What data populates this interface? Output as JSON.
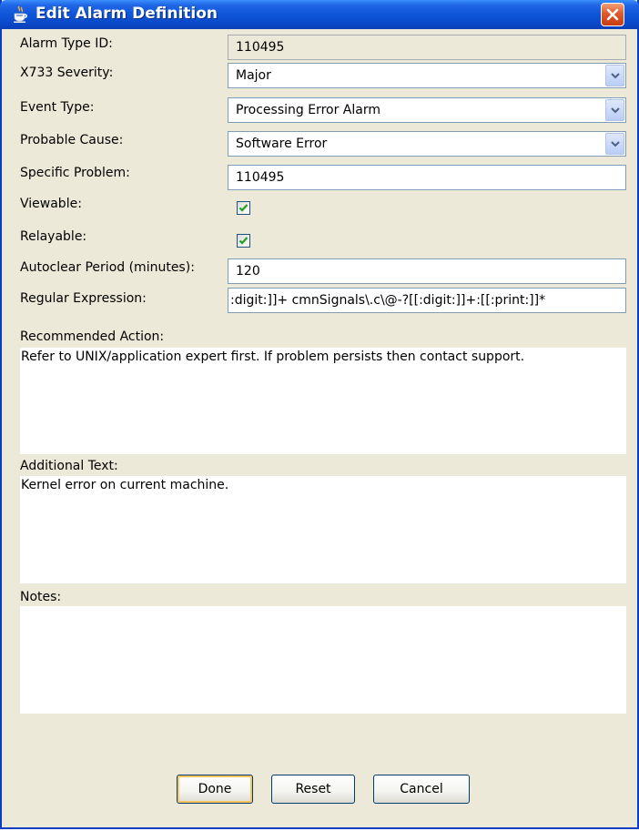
{
  "window": {
    "title": "Edit Alarm Definition",
    "icon": "java-cup-icon"
  },
  "form": {
    "alarm_type_id": {
      "label": "Alarm Type ID:",
      "value": "110495"
    },
    "x733_severity": {
      "label": "X733 Severity:",
      "value": "Major"
    },
    "event_type": {
      "label": "Event Type:",
      "value": "Processing Error Alarm"
    },
    "probable_cause": {
      "label": "Probable Cause:",
      "value": "Software Error"
    },
    "specific_problem": {
      "label": "Specific Problem:",
      "value": "110495"
    },
    "viewable": {
      "label": "Viewable:",
      "checked": true
    },
    "relayable": {
      "label": "Relayable:",
      "checked": true
    },
    "autoclear_period": {
      "label": "Autoclear Period (minutes):",
      "value": "120"
    },
    "regular_expression": {
      "label": "Regular Expression:",
      "value": ":digit:]]+ cmnSignals\\.c\\@-?[[:digit:]]+:[[:print:]]*"
    }
  },
  "recommended_action": {
    "label": "Recommended Action:",
    "text": "Refer to UNIX/application expert first. If problem persists then contact support."
  },
  "additional_text": {
    "label": "Additional Text:",
    "text": "Kernel error on current machine."
  },
  "notes": {
    "label": "Notes:",
    "text": ""
  },
  "buttons": {
    "done": "Done",
    "reset": "Reset",
    "cancel": "Cancel"
  },
  "colors": {
    "titlebar": "#0a49c9",
    "window_bg": "#ece9d8",
    "close_button": "#e05a2c",
    "checkmark": "#21a121"
  }
}
